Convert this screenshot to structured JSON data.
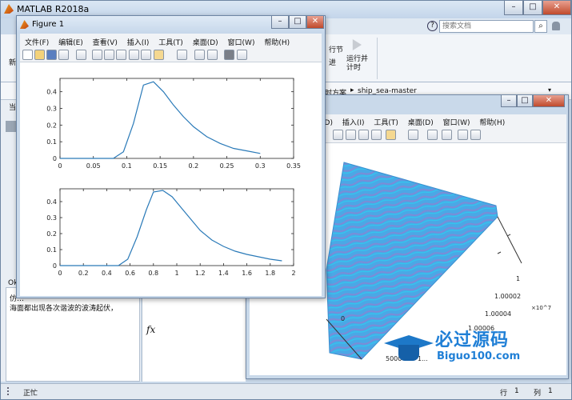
{
  "main_window": {
    "title": "MATLAB R2018a",
    "search_placeholder": "搜索文档",
    "ribbon_run_section": "运行并计时",
    "ribbon_run_line2": "计时",
    "ribbon_section_label": "行节",
    "ribbon_label2": "进",
    "ribbon_new_label": "新",
    "path_text": "ship_sea-master",
    "path_prefix": "时方案",
    "path_arrow": "▸",
    "left_partial": "当",
    "editor_line1": "仿…",
    "editor_text": "海面都出现各次谐波的波涛起伏，",
    "fx": "fx",
    "status_left": "正忙",
    "status_row_label": "行",
    "status_row": "1",
    "status_col_label": "列",
    "status_col": "1",
    "ok_partial": "Ok",
    "window_controls": [
      "–",
      "□",
      "✕"
    ]
  },
  "figure1": {
    "title": "Figure 1",
    "menu": [
      "文件(F)",
      "编辑(E)",
      "查看(V)",
      "插入(I)",
      "工具(T)",
      "桌面(D)",
      "窗口(W)",
      "帮助(H)"
    ],
    "window_controls": [
      "–",
      "□",
      "✕"
    ]
  },
  "figure2": {
    "menu": [
      "(D)",
      "插入(I)",
      "工具(T)",
      "桌面(D)",
      "窗口(W)",
      "帮助(H)"
    ],
    "window_controls": [
      "–",
      "□",
      "✕"
    ],
    "axis_labels": {
      "y_ticks": [
        "1",
        "1.00002",
        "1.00004",
        "1.00006"
      ],
      "y_exponent": "×10^7",
      "x_ticks": [
        "0",
        "5000",
        "1..."
      ],
      "z_tick": "0"
    }
  },
  "chart_data": [
    {
      "type": "line",
      "xlim": [
        0,
        0.35
      ],
      "ylim": [
        0,
        0.48
      ],
      "xticks": [
        "0",
        "0.05",
        "0.1",
        "0.15",
        "0.2",
        "0.25",
        "0.3",
        "0.35"
      ],
      "yticks": [
        "0",
        "0.1",
        "0.2",
        "0.3",
        "0.4"
      ],
      "x": [
        0,
        0.08,
        0.095,
        0.11,
        0.125,
        0.14,
        0.155,
        0.17,
        0.185,
        0.2,
        0.22,
        0.24,
        0.26,
        0.28,
        0.3
      ],
      "y": [
        0,
        0,
        0.04,
        0.21,
        0.44,
        0.46,
        0.4,
        0.32,
        0.25,
        0.19,
        0.13,
        0.09,
        0.06,
        0.045,
        0.03
      ]
    },
    {
      "type": "line",
      "xlim": [
        0,
        2
      ],
      "ylim": [
        0,
        0.48
      ],
      "xticks": [
        "0",
        "0.2",
        "0.4",
        "0.6",
        "0.8",
        "1",
        "1.2",
        "1.4",
        "1.6",
        "1.8",
        "2"
      ],
      "yticks": [
        "0",
        "0.1",
        "0.2",
        "0.3",
        "0.4"
      ],
      "x": [
        0,
        0.5,
        0.58,
        0.66,
        0.74,
        0.8,
        0.88,
        0.96,
        1.04,
        1.12,
        1.2,
        1.3,
        1.4,
        1.5,
        1.6,
        1.7,
        1.8,
        1.9
      ],
      "y": [
        0,
        0,
        0.04,
        0.18,
        0.35,
        0.46,
        0.47,
        0.43,
        0.36,
        0.29,
        0.22,
        0.16,
        0.12,
        0.09,
        0.07,
        0.055,
        0.04,
        0.03
      ]
    }
  ],
  "watermark": {
    "name": "必过源码",
    "url": "Biguo100.com"
  }
}
